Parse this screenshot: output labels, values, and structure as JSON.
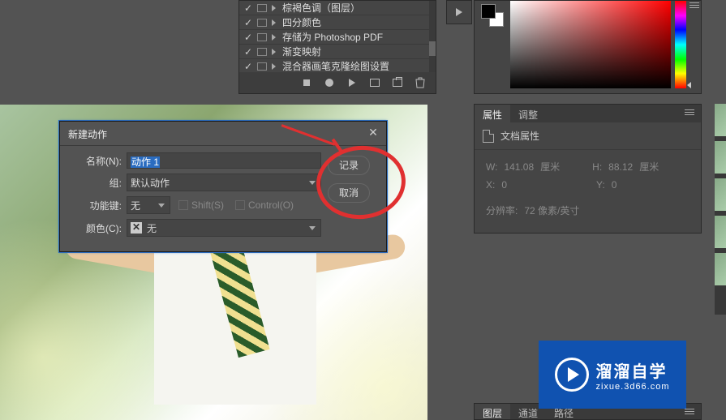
{
  "actions_panel": {
    "items": [
      {
        "label": "棕褐色调（图层）"
      },
      {
        "label": "四分颜色"
      },
      {
        "label": "存储为 Photoshop PDF"
      },
      {
        "label": "渐变映射"
      },
      {
        "label": "混合器画笔克隆绘图设置"
      }
    ]
  },
  "properties_panel": {
    "tabs": {
      "properties": "属性",
      "adjust": "调整"
    },
    "doc_props_label": "文档属性",
    "w_label": "W:",
    "w_value": "141.08",
    "w_unit": "厘米",
    "h_label": "H:",
    "h_value": "88.12",
    "h_unit": "厘米",
    "x_label": "X:",
    "x_value": "0",
    "y_label": "Y:",
    "y_value": "0",
    "res_label": "分辨率:",
    "res_value": "72 像素/英寸"
  },
  "dialog": {
    "title": "新建动作",
    "name_label": "名称(N):",
    "name_value": "动作 1",
    "set_label": "组:",
    "set_value": "默认动作",
    "fkey_label": "功能键:",
    "fkey_value": "无",
    "shift_label": "Shift(S)",
    "control_label": "Control(O)",
    "color_label": "颜色(C):",
    "color_value": "无",
    "record_btn": "记录",
    "cancel_btn": "取消"
  },
  "bottom_tabs": {
    "layers": "图层",
    "channels": "通道",
    "paths": "路径"
  },
  "watermark": {
    "title": "溜溜自学",
    "url": "zixue.3d66.com"
  }
}
